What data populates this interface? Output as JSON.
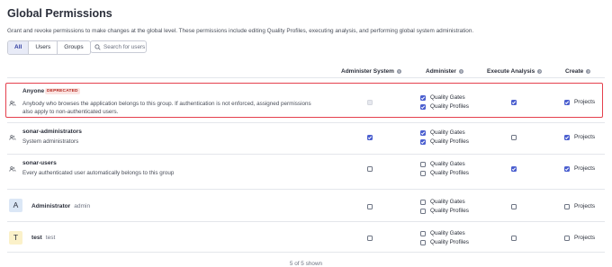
{
  "page": {
    "title": "Global Permissions",
    "description": "Grant and revoke permissions to make changes at the global level. These permissions include editing Quality Profiles, executing analysis, and performing global system administration."
  },
  "filters": {
    "all": "All",
    "users": "Users",
    "groups": "Groups",
    "active": "All"
  },
  "search": {
    "placeholder": "Search for users"
  },
  "columns": {
    "administer_system": "Administer System",
    "administer": "Administer",
    "execute_analysis": "Execute Analysis",
    "create": "Create"
  },
  "labels": {
    "quality_gates": "Quality Gates",
    "quality_profiles": "Quality Profiles",
    "projects": "Projects"
  },
  "rows": [
    {
      "name": "Anyone",
      "badge": "DEPRECATED",
      "description_line1": "Anybody who browses the application belongs to this group. If authentication is not enforced, assigned permissions",
      "description_line2": "also apply to non-authenticated users.",
      "administer_system": false,
      "administer_system_disabled": true,
      "quality_gates": true,
      "quality_profiles": true,
      "execute_analysis": true,
      "projects": true
    },
    {
      "name": "sonar-administrators",
      "description": "System administrators",
      "administer_system": true,
      "quality_gates": true,
      "quality_profiles": true,
      "execute_analysis": false,
      "projects": true
    },
    {
      "name": "sonar-users",
      "description": "Every authenticated user automatically belongs to this group",
      "administer_system": false,
      "quality_gates": false,
      "quality_profiles": false,
      "execute_analysis": true,
      "projects": true
    },
    {
      "name": "Administrator",
      "login": "admin",
      "avatar_letter": "A",
      "avatar_color": "#dbe7f6",
      "administer_system": false,
      "quality_gates": false,
      "quality_profiles": false,
      "execute_analysis": false,
      "projects": false
    },
    {
      "name": "test",
      "login": "test",
      "avatar_letter": "T",
      "avatar_color": "#fbf1c9",
      "administer_system": false,
      "quality_gates": false,
      "quality_profiles": false,
      "execute_analysis": false,
      "projects": false
    }
  ],
  "footer": {
    "shown": "5 of 5 shown"
  },
  "colors": {
    "accent": "#4b5fcf",
    "highlight_border": "#e5404d",
    "deprecated": "#b3261e"
  }
}
